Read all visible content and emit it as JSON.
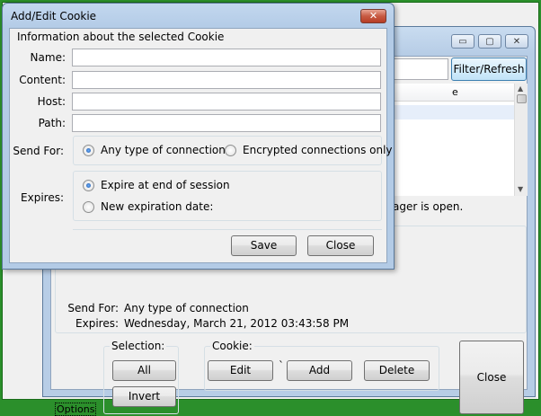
{
  "background_window": {
    "filter_button": "Filter/Refresh",
    "list_header_tail": "e",
    "status_tail": "ager is open.",
    "details": {
      "send_for_label": "Send For:",
      "send_for_value": "Any type of connection",
      "expires_label": "Expires:",
      "expires_value": "Wednesday, March 21, 2012 03:43:58 PM"
    },
    "selection_group": {
      "title": "Selection:",
      "all": "All",
      "invert": "Invert"
    },
    "cookie_group": {
      "title": "Cookie:",
      "edit": "Edit",
      "tick": "`",
      "add": "Add",
      "delete": "Delete"
    },
    "close_button": "Close",
    "options_link": "Options",
    "window_buttons": {
      "minimize": "▭",
      "maximize": "▢",
      "close": "✕"
    }
  },
  "dialog": {
    "title": "Add/Edit Cookie",
    "close_glyph": "✕",
    "heading": "Information about the selected Cookie",
    "fields": {
      "name": {
        "label": "Name:",
        "value": ""
      },
      "content": {
        "label": "Content:",
        "value": ""
      },
      "host": {
        "label": "Host:",
        "value": ""
      },
      "path": {
        "label": "Path:",
        "value": ""
      }
    },
    "send_for": {
      "label": "Send For:",
      "options": [
        "Any type of connection",
        "Encrypted connections only"
      ],
      "selected": "Any type of connection"
    },
    "expires": {
      "label": "Expires:",
      "options": [
        "Expire at end of session",
        "New expiration date:"
      ],
      "selected": "Expire at end of session"
    },
    "save_button": "Save",
    "close_button": "Close"
  }
}
